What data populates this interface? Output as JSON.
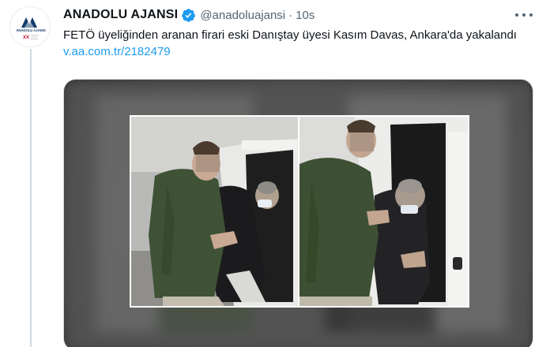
{
  "account": {
    "avatar_text": "ANADOLU AJANSI",
    "avatar_sub": "XX",
    "display_name": "ANADOLU AJANSI",
    "handle": "@anadoluajansi",
    "separator": "·",
    "time": "10s"
  },
  "tweet": {
    "text": "FETÖ üyeliğinden aranan firari eski Danıştay üyesi Kasım Davas, Ankara'da yakalandı ",
    "link": "v.aa.com.tr/2182479"
  },
  "icons": {
    "verified": "verified-badge-icon",
    "more": "more-options-icon"
  },
  "colors": {
    "link": "#1d9bf0",
    "secondary_text": "#536471",
    "brand_red": "#c8102e"
  }
}
